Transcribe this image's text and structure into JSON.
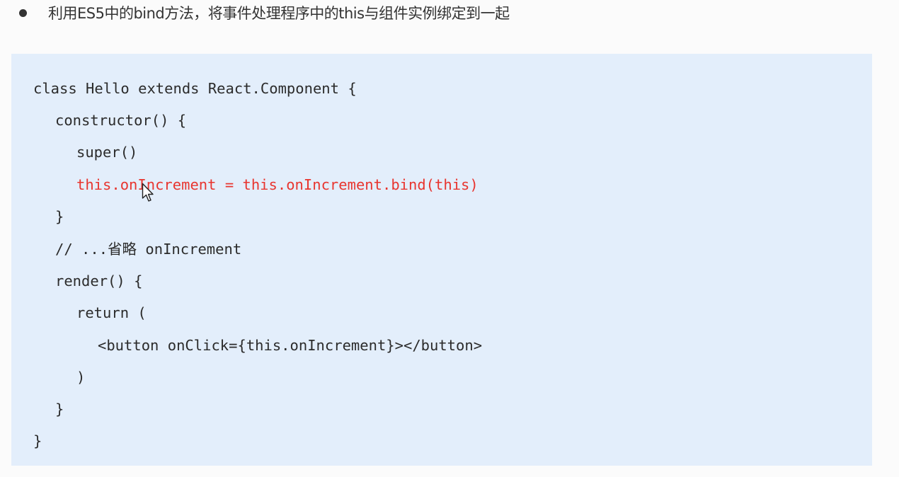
{
  "heading": {
    "text": "利用ES5中的bind方法，将事件处理程序中的this与组件实例绑定到一起"
  },
  "code": {
    "lines": [
      "class Hello extends React.Component {",
      "constructor() {",
      "super()",
      "this.onIncrement = this.onIncrement.bind(this)",
      "}",
      "// ...省略 onIncrement",
      "render() {",
      "return (",
      "<button onClick={this.onIncrement}></button>",
      ")",
      "}",
      "}"
    ]
  },
  "colors": {
    "highlight": "#e8352f",
    "code_background": "#e3eefb"
  },
  "icons": {
    "cursor": "mouse-pointer-icon"
  }
}
